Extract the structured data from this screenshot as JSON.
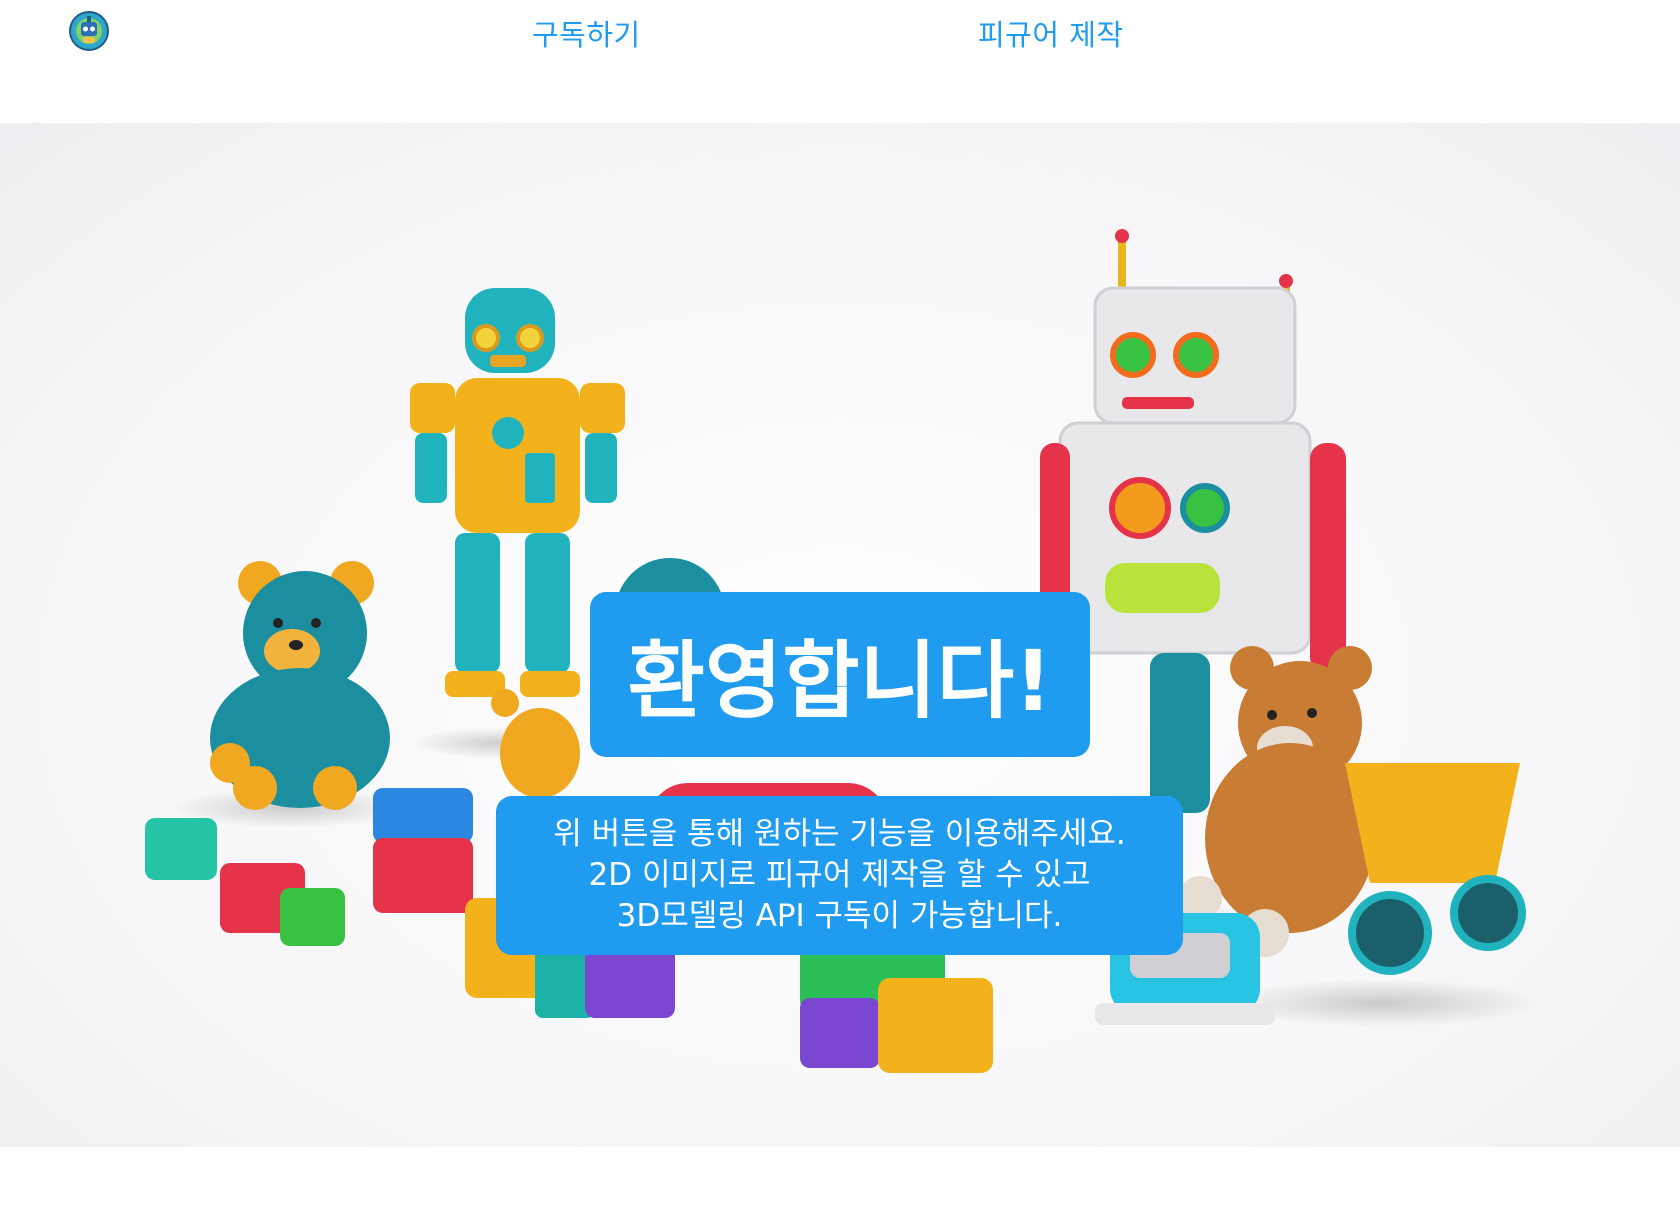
{
  "header": {
    "logo_icon": "toy-robot-badge-icon",
    "nav": [
      {
        "label": "구독하기"
      },
      {
        "label": "피규어 제작"
      }
    ]
  },
  "hero": {
    "image_icon": "toys-illustration",
    "welcome_title": "환영합니다!",
    "description_lines": [
      "위 버튼을 통해 원하는 기능을 이용해주세요.",
      "2D 이미지로 피규어 제작을 할 수 있고",
      "3D모델링 API 구독이 가능합니다."
    ]
  },
  "colors": {
    "accent": "#1f9bf0",
    "text_on_accent": "#ffffff"
  }
}
